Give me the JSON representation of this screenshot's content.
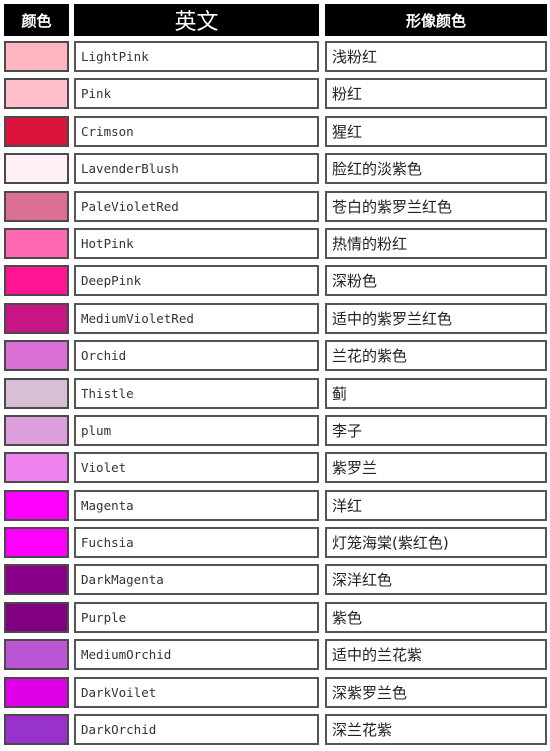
{
  "header": {
    "col_color": "颜色",
    "col_english": "英文",
    "col_chinese": "形像颜色"
  },
  "rows": [
    {
      "swatch": "#FFB6C1",
      "en": "LightPink",
      "zh": "浅粉红"
    },
    {
      "swatch": "#FFC0CB",
      "en": "Pink",
      "zh": "粉红"
    },
    {
      "swatch": "#DC143C",
      "en": "Crimson",
      "zh": "猩红"
    },
    {
      "swatch": "#FFF0F5",
      "en": "LavenderBlush",
      "zh": "脸红的淡紫色"
    },
    {
      "swatch": "#DB7093",
      "en": "PaleVioletRed",
      "zh": "苍白的紫罗兰红色"
    },
    {
      "swatch": "#FF69B4",
      "en": "HotPink",
      "zh": "热情的粉红"
    },
    {
      "swatch": "#FF1493",
      "en": "DeepPink",
      "zh": "深粉色"
    },
    {
      "swatch": "#C71585",
      "en": "MediumVioletRed",
      "zh": "适中的紫罗兰红色"
    },
    {
      "swatch": "#DA70D6",
      "en": "Orchid",
      "zh": "兰花的紫色"
    },
    {
      "swatch": "#D8BFD8",
      "en": "Thistle",
      "zh": "蓟"
    },
    {
      "swatch": "#DDA0DD",
      "en": "plum",
      "zh": "李子"
    },
    {
      "swatch": "#EE82EE",
      "en": "Violet",
      "zh": "紫罗兰"
    },
    {
      "swatch": "#FF00FF",
      "en": "Magenta",
      "zh": "洋红"
    },
    {
      "swatch": "#FF00FF",
      "en": "Fuchsia",
      "zh": "灯笼海棠(紫红色)"
    },
    {
      "swatch": "#8B008B",
      "en": "DarkMagenta",
      "zh": "深洋红色"
    },
    {
      "swatch": "#800080",
      "en": "Purple",
      "zh": "紫色"
    },
    {
      "swatch": "#BA55D3",
      "en": "MediumOrchid",
      "zh": "适中的兰花紫"
    },
    {
      "swatch": "#E000E8",
      "en": "DarkVoilet",
      "zh": "深紫罗兰色"
    },
    {
      "swatch": "#9932CC",
      "en": "DarkOrchid",
      "zh": "深兰花紫"
    }
  ]
}
